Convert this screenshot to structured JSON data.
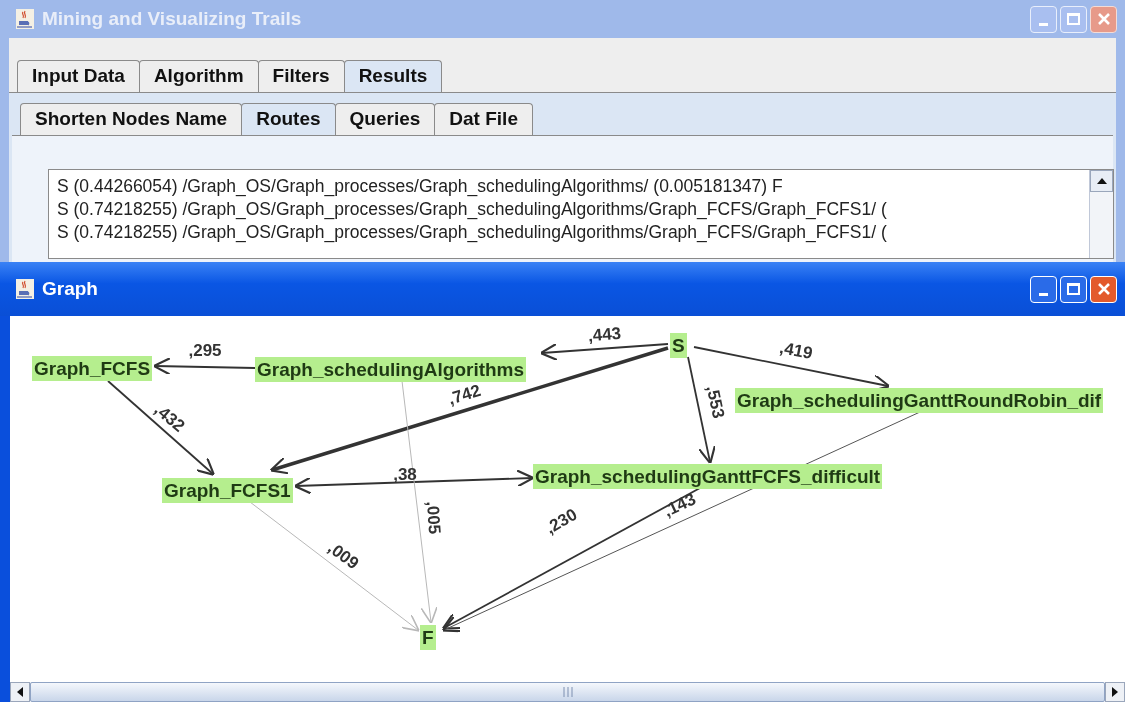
{
  "main_window": {
    "title": "Mining and Visualizing Trails"
  },
  "tabs": [
    {
      "label": "Input Data",
      "selected": false
    },
    {
      "label": "Algorithm",
      "selected": false
    },
    {
      "label": "Filters",
      "selected": false
    },
    {
      "label": "Results",
      "selected": true
    }
  ],
  "subtabs": [
    {
      "label": "Shorten Nodes Name",
      "selected": false
    },
    {
      "label": "Routes",
      "selected": true
    },
    {
      "label": "Queries",
      "selected": false
    },
    {
      "label": "Dat File",
      "selected": false
    }
  ],
  "routes": [
    "S (0.44266054) /Graph_OS/Graph_processes/Graph_schedulingAlgorithms/ (0.005181347) F",
    "S (0.74218255) /Graph_OS/Graph_processes/Graph_schedulingAlgorithms/Graph_FCFS/Graph_FCFS1/ (",
    "S (0.74218255) /Graph_OS/Graph_processes/Graph_schedulingAlgorithms/Graph_FCFS/Graph_FCFS1/ ("
  ],
  "graph_window": {
    "title": "Graph"
  },
  "nodes": [
    "S",
    "Graph_FCFS",
    "Graph_schedulingAlgorithms",
    "Graph_schedulingGanttRoundRobin_dif",
    "Graph_schedulingGanttFCFS_difficult",
    "Graph_FCFS1",
    "F"
  ],
  "edges": [
    {
      "label": ",443",
      "kind": "normal",
      "two_way": false
    },
    {
      "label": ",742",
      "kind": "heavy",
      "two_way": false
    },
    {
      "label": ",419",
      "kind": "normal",
      "two_way": false
    },
    {
      "label": ",553",
      "kind": "normal",
      "two_way": false
    },
    {
      "label": ",295",
      "kind": "normal",
      "two_way": false
    },
    {
      "label": ",432",
      "kind": "normal",
      "two_way": false
    },
    {
      "label": ",38",
      "kind": "normal",
      "two_way": true
    },
    {
      "label": ",005",
      "kind": "faint",
      "two_way": false
    },
    {
      "label": ",009",
      "kind": "faint",
      "two_way": false
    },
    {
      "label": ",230",
      "kind": "normal",
      "two_way": false
    },
    {
      "label": ",143",
      "kind": "thin",
      "two_way": false
    }
  ]
}
